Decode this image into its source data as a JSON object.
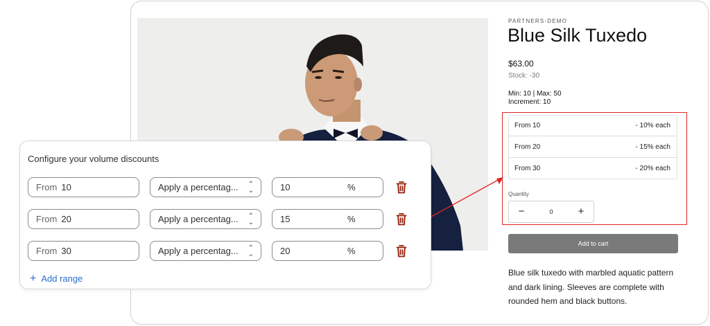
{
  "product": {
    "vendor": "PARTNERS-DEMO",
    "title": "Blue Silk Tuxedo",
    "price": "$63.00",
    "stock": "Stock: -30",
    "limits": "Min: 10 | Max: 50",
    "increment": "Increment: 10",
    "tiers": [
      {
        "from": "From 10",
        "discount": "- 10% each"
      },
      {
        "from": "From 20",
        "discount": "- 15% each"
      },
      {
        "from": "From 30",
        "discount": "- 20% each"
      }
    ],
    "quantity_label": "Quantity",
    "quantity_value": "0",
    "minus": "−",
    "plus": "+",
    "add_to_cart": "Add to cart",
    "description": "Blue silk tuxedo with marbled aquatic pattern and dark lining. Sleeves are complete with rounded hem and black buttons."
  },
  "discounts": {
    "title": "Configure your volume discounts",
    "from_prefix": "From",
    "ranges": [
      {
        "from": "10",
        "type": "Apply a percentag...",
        "value": "10",
        "suffix": "%"
      },
      {
        "from": "20",
        "type": "Apply a percentag...",
        "value": "15",
        "suffix": "%"
      },
      {
        "from": "30",
        "type": "Apply a percentag...",
        "value": "20",
        "suffix": "%"
      }
    ],
    "add_range": "Add range"
  },
  "colors": {
    "highlight": "#e02424",
    "link": "#2c6ecb",
    "trash": "#8e1f0b",
    "button": "#7a7a7a"
  },
  "icons": {
    "delete": "trash-icon",
    "select": "chevron-updown-icon",
    "add": "plus-icon"
  }
}
